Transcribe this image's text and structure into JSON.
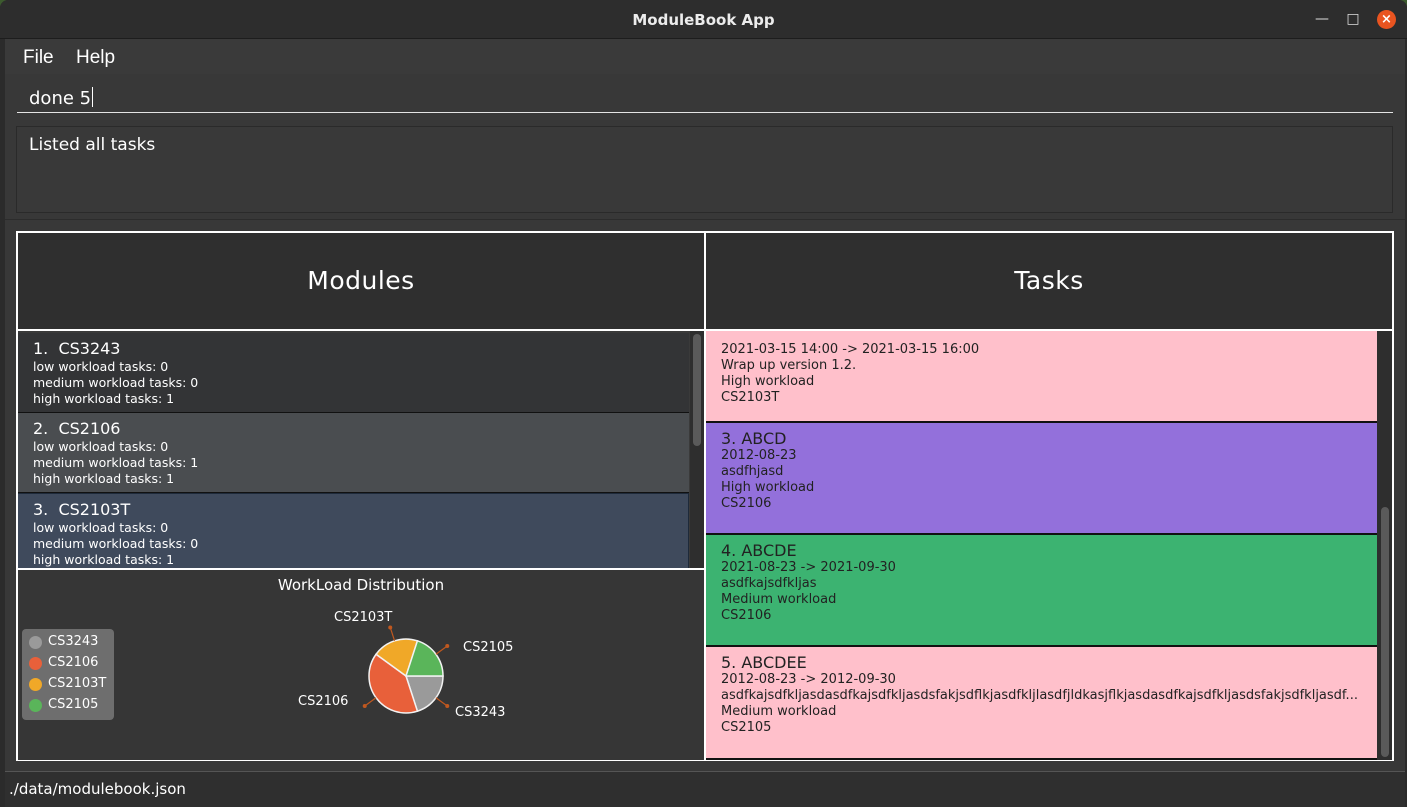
{
  "window": {
    "title": "ModuleBook App"
  },
  "menu": {
    "file": "File",
    "help": "Help"
  },
  "command": {
    "value": "done 5"
  },
  "result": {
    "text": "Listed all tasks"
  },
  "modules": {
    "header": "Modules",
    "items": [
      {
        "index": "1.",
        "code": "CS3243",
        "low": "low workload tasks: 0",
        "medium": "medium workload tasks: 0",
        "high": "high workload tasks: 1"
      },
      {
        "index": "2.",
        "code": "CS2106",
        "low": "low workload tasks: 0",
        "medium": "medium workload tasks: 1",
        "high": "high workload tasks: 1"
      },
      {
        "index": "3.",
        "code": "CS2103T",
        "low": "low workload tasks: 0",
        "medium": "medium workload tasks: 0",
        "high": "high workload tasks: 1"
      }
    ]
  },
  "chart": {
    "title": "WorkLoad Distribution",
    "legend": [
      "CS3243",
      "CS2106",
      "CS2103T",
      "CS2105"
    ],
    "labels": {
      "cs2103t": "CS2103T",
      "cs2105": "CS2105",
      "cs2106": "CS2106",
      "cs3243": "CS3243"
    }
  },
  "chart_data": {
    "type": "pie",
    "title": "WorkLoad Distribution",
    "categories": [
      "CS3243",
      "CS2106",
      "CS2103T",
      "CS2105"
    ],
    "values": [
      1,
      2,
      1,
      1
    ],
    "colors": [
      "#9a9a9a",
      "#e8603a",
      "#f0a828",
      "#5ab55a"
    ],
    "legend_position": "left"
  },
  "tasks": {
    "header": "Tasks",
    "items": [
      {
        "title": "",
        "time": "2021-03-15 14:00 -> 2021-03-15 16:00",
        "desc": "Wrap up version 1.2.",
        "workload": "High workload",
        "module": "CS2103T",
        "color": "#ffc0cb"
      },
      {
        "title": "3.  ABCD",
        "time": "2012-08-23",
        "desc": "asdfhjasd",
        "workload": "High workload",
        "module": "CS2106",
        "color": "#9370db"
      },
      {
        "title": "4.  ABCDE",
        "time": "2021-08-23 -> 2021-09-30",
        "desc": "asdfkajsdfkljas",
        "workload": "Medium workload",
        "module": "CS2106",
        "color": "#3cb371"
      },
      {
        "title": "5.  ABCDEE",
        "time": "2012-08-23 -> 2012-09-30",
        "desc": "asdfkajsdfkljasdasdfkajsdfkljasdsfakjsdflkjasdfkljlasdfjldkasjflkjasdasdfkajsdfkljasdsfakjsdfkljasdf...",
        "workload": "Medium workload",
        "module": "CS2105",
        "color": "#ffc0cb"
      }
    ]
  },
  "status": {
    "path": "./data/modulebook.json"
  }
}
